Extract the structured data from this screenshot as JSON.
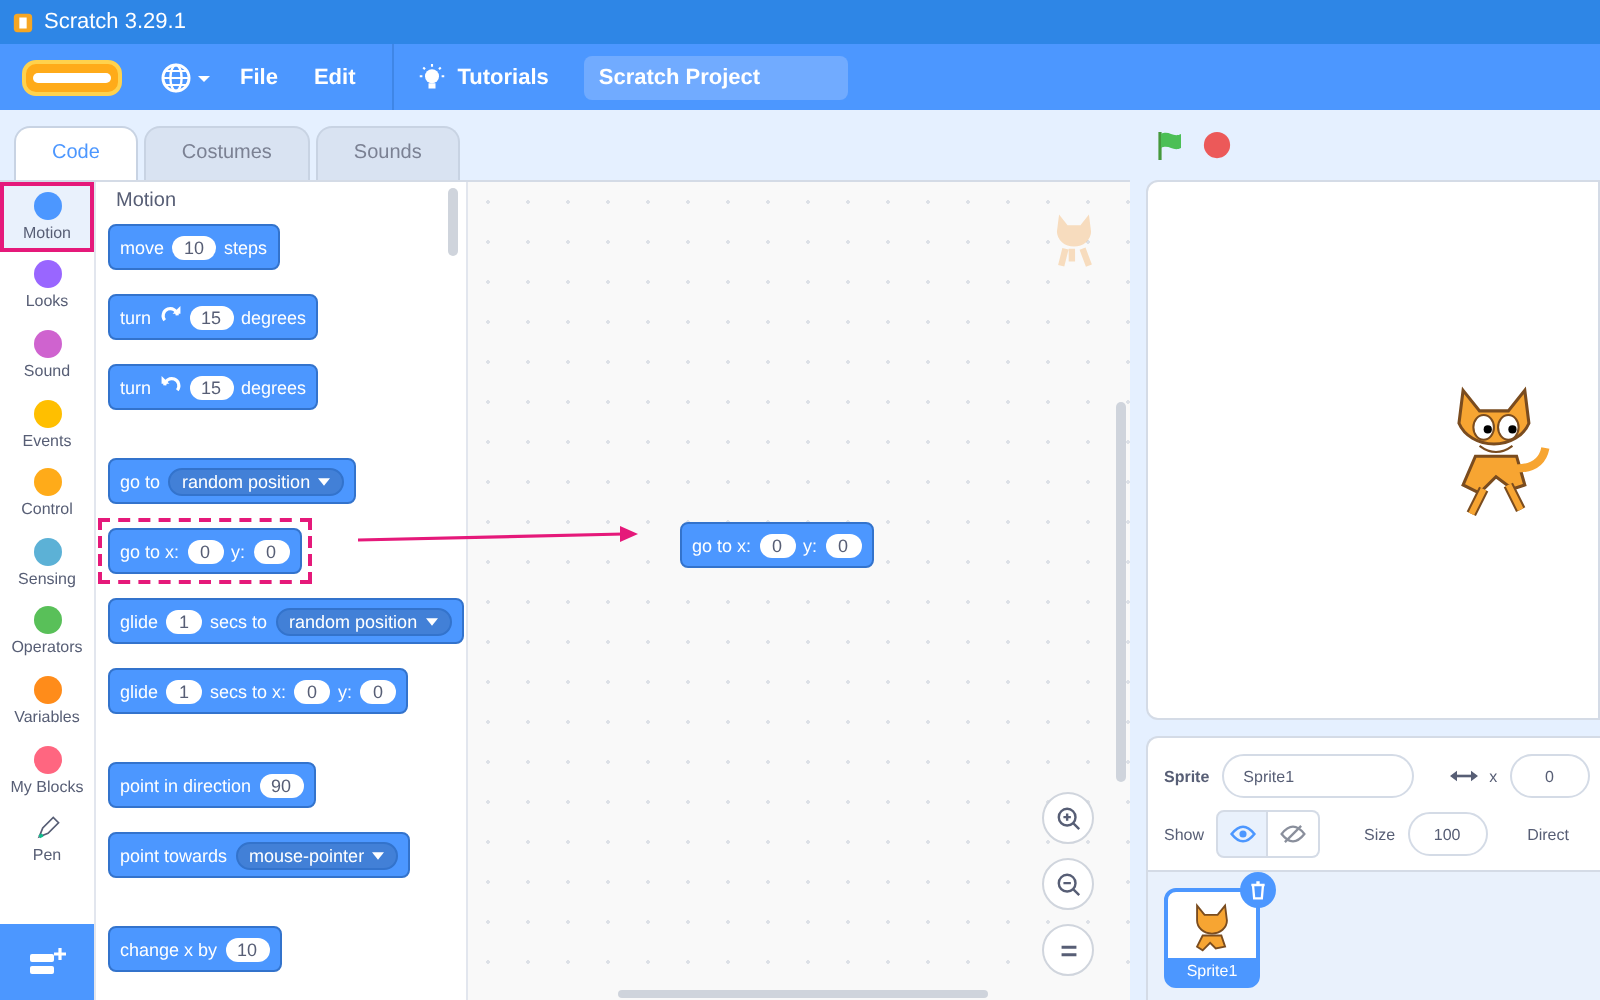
{
  "window": {
    "title": "Scratch 3.29.1"
  },
  "menu": {
    "items": [
      "File",
      "Edit"
    ],
    "tutorials": "Tutorials",
    "project_title": "Scratch Project"
  },
  "tabs": [
    {
      "label": "Code",
      "selected": true
    },
    {
      "label": "Costumes",
      "selected": false
    },
    {
      "label": "Sounds",
      "selected": false
    }
  ],
  "categories": [
    {
      "kind": "dot",
      "label": "Motion",
      "color": "#4c97ff",
      "selected": true
    },
    {
      "kind": "dot",
      "label": "Looks",
      "color": "#9966ff",
      "selected": false
    },
    {
      "kind": "dot",
      "label": "Sound",
      "color": "#cf63cf",
      "selected": false
    },
    {
      "kind": "dot",
      "label": "Events",
      "color": "#ffbf00",
      "selected": false
    },
    {
      "kind": "dot",
      "label": "Control",
      "color": "#ffab19",
      "selected": false
    },
    {
      "kind": "dot",
      "label": "Sensing",
      "color": "#5cb1d6",
      "selected": false
    },
    {
      "kind": "dot",
      "label": "Operators",
      "color": "#59c059",
      "selected": false
    },
    {
      "kind": "dot",
      "label": "Variables",
      "color": "#ff8c1a",
      "selected": false
    },
    {
      "kind": "dot",
      "label": "My Blocks",
      "color": "#ff6680",
      "selected": false
    },
    {
      "kind": "extension",
      "label": "Pen",
      "selected": false
    }
  ],
  "palette": {
    "heading": "Motion",
    "groups": [
      {
        "blocks": [
          {
            "highlighted": false,
            "parts": [
              {
                "kind": "text",
                "text": "move"
              },
              {
                "kind": "number",
                "text": "10"
              },
              {
                "kind": "text",
                "text": "steps"
              }
            ]
          },
          {
            "highlighted": false,
            "parts": [
              {
                "kind": "text",
                "text": "turn"
              },
              {
                "kind": "rotate_cw"
              },
              {
                "kind": "number",
                "text": "15"
              },
              {
                "kind": "text",
                "text": "degrees"
              }
            ]
          },
          {
            "highlighted": false,
            "parts": [
              {
                "kind": "text",
                "text": "turn"
              },
              {
                "kind": "rotate_ccw"
              },
              {
                "kind": "number",
                "text": "15"
              },
              {
                "kind": "text",
                "text": "degrees"
              }
            ]
          }
        ]
      },
      {
        "blocks": [
          {
            "highlighted": false,
            "parts": [
              {
                "kind": "text",
                "text": "go to"
              },
              {
                "kind": "dropdown",
                "text": "random position"
              }
            ]
          },
          {
            "highlighted": true,
            "parts": [
              {
                "kind": "text",
                "text": "go to x:"
              },
              {
                "kind": "number",
                "text": "0"
              },
              {
                "kind": "text",
                "text": "y:"
              },
              {
                "kind": "number",
                "text": "0"
              }
            ]
          },
          {
            "highlighted": false,
            "parts": [
              {
                "kind": "text",
                "text": "glide"
              },
              {
                "kind": "number",
                "text": "1"
              },
              {
                "kind": "text",
                "text": "secs to"
              },
              {
                "kind": "dropdown",
                "text": "random position"
              }
            ]
          },
          {
            "highlighted": false,
            "parts": [
              {
                "kind": "text",
                "text": "glide"
              },
              {
                "kind": "number",
                "text": "1"
              },
              {
                "kind": "text",
                "text": "secs to x:"
              },
              {
                "kind": "number",
                "text": "0"
              },
              {
                "kind": "text",
                "text": "y:"
              },
              {
                "kind": "number",
                "text": "0"
              }
            ]
          }
        ]
      },
      {
        "blocks": [
          {
            "highlighted": false,
            "parts": [
              {
                "kind": "text",
                "text": "point in direction"
              },
              {
                "kind": "number",
                "text": "90"
              }
            ]
          },
          {
            "highlighted": false,
            "parts": [
              {
                "kind": "text",
                "text": "point towards"
              },
              {
                "kind": "dropdown",
                "text": "mouse-pointer"
              }
            ]
          }
        ]
      },
      {
        "blocks": [
          {
            "highlighted": false,
            "parts": [
              {
                "kind": "text",
                "text": "change x by"
              },
              {
                "kind": "number",
                "text": "10"
              }
            ]
          }
        ]
      }
    ]
  },
  "workspace": {
    "blocks": [
      {
        "parts": [
          {
            "kind": "text",
            "text": "go to x:"
          },
          {
            "kind": "number",
            "text": "0"
          },
          {
            "kind": "text",
            "text": "y:"
          },
          {
            "kind": "number",
            "text": "0"
          }
        ]
      }
    ]
  },
  "sprite_info": {
    "sprite_label": "Sprite",
    "sprite_name": "Sprite1",
    "x_label": "x",
    "x_value": "0",
    "show_label": "Show",
    "visible": true,
    "size_label": "Size",
    "size_value": "100",
    "direction_label": "Direct"
  },
  "sprites": [
    {
      "name": "Sprite1",
      "selected": true
    }
  ]
}
